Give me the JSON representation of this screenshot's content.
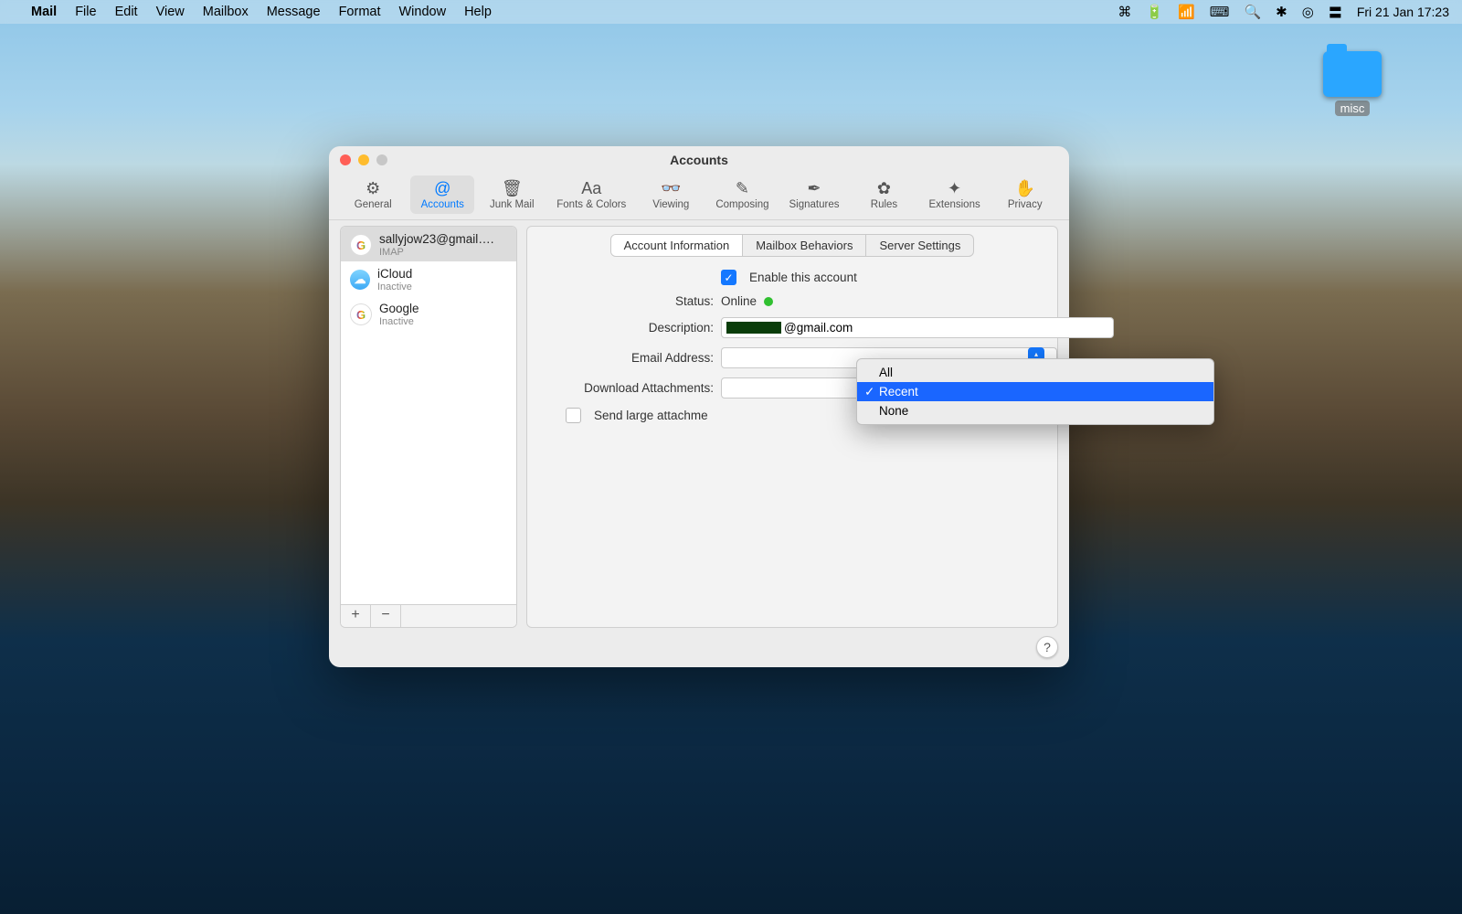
{
  "menubar": {
    "app": "Mail",
    "items": [
      "File",
      "Edit",
      "View",
      "Mailbox",
      "Message",
      "Format",
      "Window",
      "Help"
    ],
    "clock": "Fri 21 Jan  17:23"
  },
  "desktop": {
    "folder_label": "misc"
  },
  "window": {
    "title": "Accounts",
    "toolbar": [
      {
        "label": "General",
        "icon": "⚙"
      },
      {
        "label": "Accounts",
        "icon": "@",
        "selected": true
      },
      {
        "label": "Junk Mail",
        "icon": "🗑"
      },
      {
        "label": "Fonts & Colors",
        "icon": "Aa"
      },
      {
        "label": "Viewing",
        "icon": "👓"
      },
      {
        "label": "Composing",
        "icon": "✎"
      },
      {
        "label": "Signatures",
        "icon": "✒"
      },
      {
        "label": "Rules",
        "icon": "✿"
      },
      {
        "label": "Extensions",
        "icon": "✦"
      },
      {
        "label": "Privacy",
        "icon": "✋"
      }
    ],
    "accounts": [
      {
        "name": "sallyjow23@gmail….",
        "sub": "IMAP",
        "type": "google",
        "selected": true
      },
      {
        "name": "iCloud",
        "sub": "Inactive",
        "type": "icloud"
      },
      {
        "name": "Google",
        "sub": "Inactive",
        "type": "google"
      }
    ],
    "footer": {
      "add": "+",
      "remove": "−"
    },
    "tabs": {
      "items": [
        "Account Information",
        "Mailbox Behaviors",
        "Server Settings"
      ],
      "active": 0
    },
    "form": {
      "enable_label": "Enable this account",
      "enable_checked": true,
      "status_label": "Status:",
      "status_value": "Online",
      "description_label": "Description:",
      "description_value": "@gmail.com",
      "email_label": "Email Address:",
      "download_label": "Download Attachments:",
      "largeattach_label": "Send large attachme",
      "largeattach_checked": false
    },
    "dropdown": {
      "options": [
        "All",
        "Recent",
        "None"
      ],
      "selected": "Recent"
    },
    "help": "?"
  }
}
